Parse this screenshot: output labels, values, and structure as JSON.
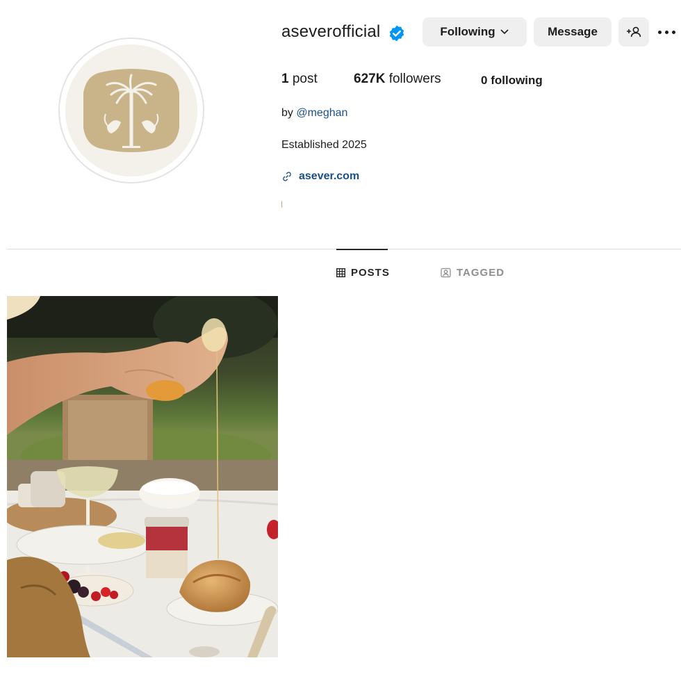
{
  "profile": {
    "username": "aseverofficial",
    "verified_icon": "verified-badge-icon",
    "following_label": "Following",
    "message_label": "Message",
    "add_user_icon": "add-user-icon",
    "more_icon": "more-options-icon"
  },
  "stats": {
    "posts_count": "1",
    "posts_label": "post",
    "followers_count": "627K",
    "followers_label": "followers",
    "following_count": "0",
    "following_label": "following"
  },
  "bio": {
    "by_prefix": "by",
    "by_handle": "@meghan",
    "established": "Established 2025",
    "link_icon": "link-icon",
    "link_text": "asever.com"
  },
  "tabs": [
    {
      "label": "POSTS",
      "icon": "grid-icon",
      "active": true
    },
    {
      "label": "TAGGED",
      "icon": "tagged-icon",
      "active": false
    }
  ],
  "colors": {
    "verified": "#0095f6",
    "link": "#1a4f87",
    "logo": "#c9b48a",
    "button_bg": "#efefef"
  }
}
